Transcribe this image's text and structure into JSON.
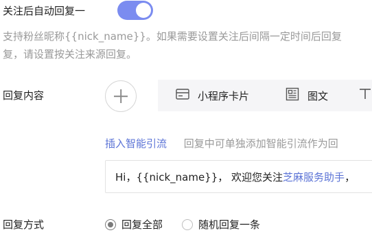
{
  "auto_reply": {
    "title": "关注后自动回复一",
    "toggle_on": true,
    "toggle_color": "#7b8cf0",
    "description_line1": "支持粉丝昵称{{nick_name}}。如果需要设置关注后间隔一定时间后回复",
    "description_line2": "复，请设置按关注来源回复。"
  },
  "content": {
    "label": "回复内容",
    "add_icon": "plus-icon",
    "types": [
      {
        "label": "小程序卡片",
        "icon": "mini-program-card-icon"
      },
      {
        "label": "图文",
        "icon": "article-icon"
      },
      {
        "label": "",
        "icon": "text-icon"
      }
    ],
    "insert_link": "插入智能引流",
    "insert_hint": "回复中可单独添加智能引流作为回",
    "message_prefix": "Hi，{{nick_name}}， 欢迎您关注",
    "message_account": "芝麻服务助手",
    "message_suffix": "，",
    "accent_color": "#5b73d6"
  },
  "method": {
    "label": "回复方式",
    "options": [
      {
        "label": "回复全部",
        "selected": true
      },
      {
        "label": "随机回复一条",
        "selected": false
      }
    ]
  }
}
